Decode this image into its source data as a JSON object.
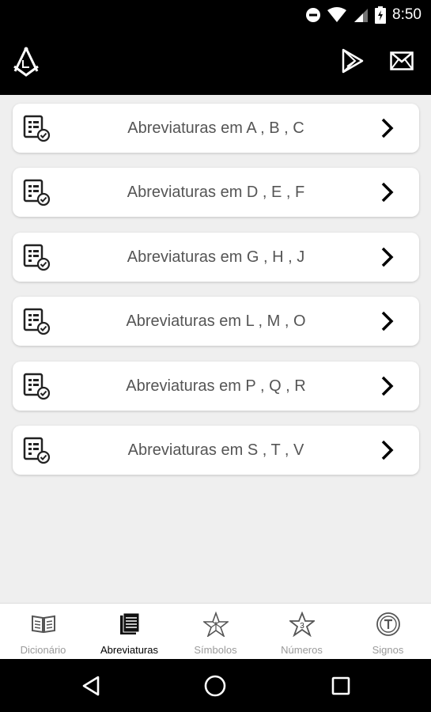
{
  "status_bar": {
    "time": "8:50",
    "icons": [
      "do-not-disturb-icon",
      "wifi-icon",
      "cell-signal-icon",
      "battery-charging-icon"
    ]
  },
  "app_bar": {
    "logo_icon": "masonic-compass-square-icon",
    "actions": [
      "google-play-icon",
      "mail-icon"
    ]
  },
  "list": {
    "items": [
      {
        "label": "Abreviaturas em A , B , C"
      },
      {
        "label": "Abreviaturas em D , E , F"
      },
      {
        "label": "Abreviaturas em G , H , J"
      },
      {
        "label": "Abreviaturas em L , M , O"
      },
      {
        "label": "Abreviaturas em P , Q , R"
      },
      {
        "label": "Abreviaturas em S , T , V"
      }
    ]
  },
  "bottom_nav": {
    "items": [
      {
        "label": "Dicionário",
        "icon": "open-book-icon",
        "active": false
      },
      {
        "label": "Abreviaturas",
        "icon": "book-pages-icon",
        "active": true
      },
      {
        "label": "Símbolos",
        "icon": "pentagram-icon",
        "active": false
      },
      {
        "label": "Números",
        "icon": "star-number-icon",
        "active": false
      },
      {
        "label": "Signos",
        "icon": "tau-seal-icon",
        "active": false
      }
    ]
  },
  "colors": {
    "bars": "#000000",
    "background": "#efefef",
    "card": "#ffffff",
    "label": "#555555",
    "nav_active": "#000000",
    "nav_inactive": "#9a9a9a"
  }
}
